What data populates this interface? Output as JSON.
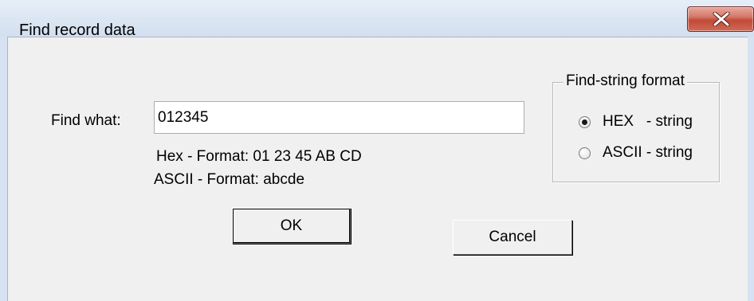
{
  "window": {
    "title": "Find record data"
  },
  "form": {
    "find_label": "Find what:",
    "find_value": "012345",
    "hex_hint": "Hex    - Format: 01 23 45 AB CD",
    "ascii_hint": "ASCII - Format: abcde"
  },
  "format_group": {
    "legend": "Find-string format",
    "options": [
      {
        "label": "HEX   - string",
        "checked": true
      },
      {
        "label": "ASCII - string",
        "checked": false
      }
    ]
  },
  "buttons": {
    "ok_label": "OK",
    "cancel_label": "Cancel"
  },
  "icons": {
    "close": "close-icon"
  },
  "colors": {
    "titlebar": "#dbe6f3",
    "close_button": "#c24a38",
    "dialog_background": "#f0f0f0"
  }
}
